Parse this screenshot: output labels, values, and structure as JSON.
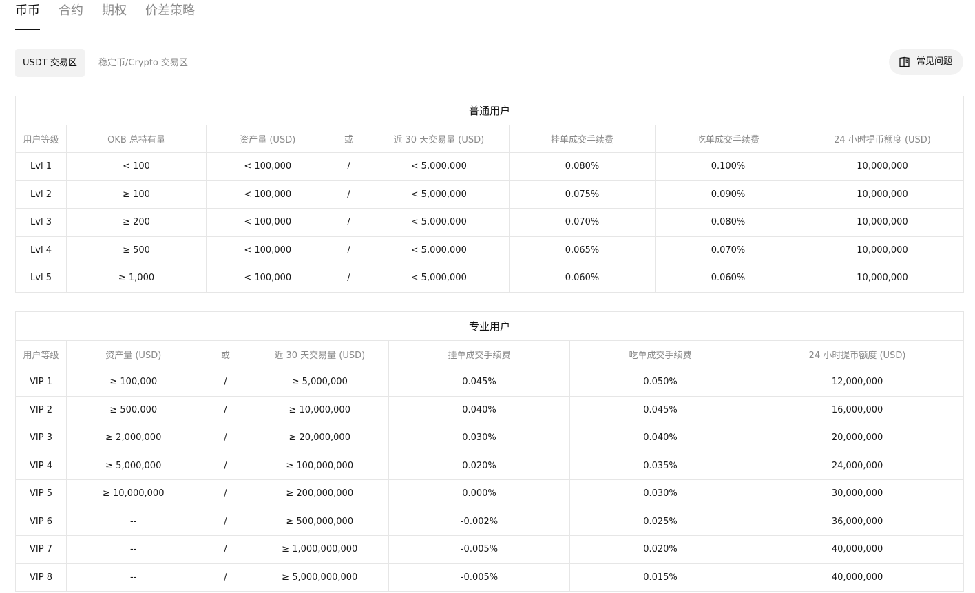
{
  "tabs": [
    {
      "label": "币币",
      "active": true
    },
    {
      "label": "合约",
      "active": false
    },
    {
      "label": "期权",
      "active": false
    },
    {
      "label": "价差策略",
      "active": false
    }
  ],
  "zones": [
    {
      "label": "USDT 交易区",
      "active": true
    },
    {
      "label": "稳定币/Crypto 交易区",
      "active": false
    }
  ],
  "faq": {
    "label": "常见问题",
    "icon": "book-icon"
  },
  "regular": {
    "title": "普通用户",
    "headers": [
      "用户等级",
      "OKB 总持有量",
      "资产量 (USD)",
      "或",
      "近 30 天交易量 (USD)",
      "挂单成交手续费",
      "吃单成交手续费",
      "24 小时提币额度 (USD)"
    ],
    "rows": [
      [
        "Lvl 1",
        "< 100",
        "< 100,000",
        "/",
        "< 5,000,000",
        "0.080%",
        "0.100%",
        "10,000,000"
      ],
      [
        "Lvl 2",
        "≥ 100",
        "< 100,000",
        "/",
        "< 5,000,000",
        "0.075%",
        "0.090%",
        "10,000,000"
      ],
      [
        "Lvl 3",
        "≥ 200",
        "< 100,000",
        "/",
        "< 5,000,000",
        "0.070%",
        "0.080%",
        "10,000,000"
      ],
      [
        "Lvl 4",
        "≥ 500",
        "< 100,000",
        "/",
        "< 5,000,000",
        "0.065%",
        "0.070%",
        "10,000,000"
      ],
      [
        "Lvl 5",
        "≥ 1,000",
        "< 100,000",
        "/",
        "< 5,000,000",
        "0.060%",
        "0.060%",
        "10,000,000"
      ]
    ]
  },
  "pro": {
    "title": "专业用户",
    "headers": [
      "用户等级",
      "资产量 (USD)",
      "或",
      "近 30 天交易量 (USD)",
      "挂单成交手续费",
      "吃单成交手续费",
      "24 小时提币额度 (USD)"
    ],
    "rows": [
      [
        "VIP 1",
        "≥ 100,000",
        "/",
        "≥ 5,000,000",
        "0.045%",
        "0.050%",
        "12,000,000"
      ],
      [
        "VIP 2",
        "≥ 500,000",
        "/",
        "≥ 10,000,000",
        "0.040%",
        "0.045%",
        "16,000,000"
      ],
      [
        "VIP 3",
        "≥ 2,000,000",
        "/",
        "≥ 20,000,000",
        "0.030%",
        "0.040%",
        "20,000,000"
      ],
      [
        "VIP 4",
        "≥ 5,000,000",
        "/",
        "≥ 100,000,000",
        "0.020%",
        "0.035%",
        "24,000,000"
      ],
      [
        "VIP 5",
        "≥ 10,000,000",
        "/",
        "≥ 200,000,000",
        "0.000%",
        "0.030%",
        "30,000,000"
      ],
      [
        "VIP 6",
        "--",
        "/",
        "≥ 500,000,000",
        "-0.002%",
        "0.025%",
        "36,000,000"
      ],
      [
        "VIP 7",
        "--",
        "/",
        "≥ 1,000,000,000",
        "-0.005%",
        "0.020%",
        "40,000,000"
      ],
      [
        "VIP 8",
        "--",
        "/",
        "≥ 5,000,000,000",
        "-0.005%",
        "0.015%",
        "40,000,000"
      ]
    ]
  }
}
